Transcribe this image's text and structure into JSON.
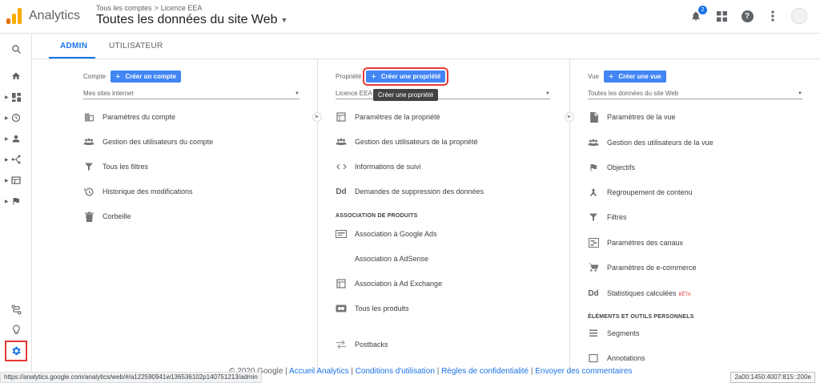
{
  "header": {
    "app_name": "Analytics",
    "breadcrumb_account": "Tous les comptes",
    "breadcrumb_sep": ">",
    "breadcrumb_property": "Licence EEA",
    "view_title": "Toutes les données du site Web",
    "notification_count": "2"
  },
  "tabs": {
    "admin": "ADMIN",
    "user": "UTILISATEUR"
  },
  "account": {
    "label": "Compte",
    "create": "Créer un compte",
    "selected": "Mes sites internet",
    "items": [
      "Paramètres du compte",
      "Gestion des utilisateurs du compte",
      "Tous les filtres",
      "Historique des modifications",
      "Corbeille"
    ]
  },
  "property": {
    "label": "Propriété",
    "create": "Créer une propriété",
    "tooltip": "Créer une propriété",
    "selected": "Licence EEA",
    "items": [
      "Paramètres de la propriété",
      "Gestion des utilisateurs de la propriété",
      "Informations de suivi",
      "Demandes de suppression des données"
    ],
    "products_heading": "ASSOCIATION DE PRODUITS",
    "product_items": [
      "Association à Google Ads",
      "Association à AdSense",
      "Association à Ad Exchange",
      "Tous les produits"
    ],
    "postbacks": "Postbacks",
    "dd_icon": "Dd"
  },
  "view": {
    "label": "Vue",
    "create": "Créer une vue",
    "selected": "Toutes les données du site Web",
    "items": [
      "Paramètres de la vue",
      "Gestion des utilisateurs de la vue",
      "Objectifs",
      "Regroupement de contenu",
      "Filtres",
      "Paramètres des canaux",
      "Paramètres de e-commerce",
      "Statistiques calculées"
    ],
    "beta": "BÊTA",
    "tools_heading": "ÉLÉMENTS ET OUTILS PERSONNELS",
    "tools_items": [
      "Segments",
      "Annotations"
    ],
    "dd_icon": "Dd"
  },
  "footer": {
    "copyright": "© 2020 Google",
    "sep": "|",
    "links": [
      "Accueil Analytics",
      "Conditions d'utilisation",
      "Règles de confidentialité",
      "Envoyer des commentaires"
    ]
  },
  "status_url": "https://analytics.google.com/analytics/web/#/a122590941w136536102p140751213/admin",
  "ip_address": "2a00:1450:4007:815::200e",
  "colors": {
    "accent": "#1a73e8",
    "button": "#4285f4",
    "highlight": "#e53935",
    "logo_orange": "#f9ab00",
    "logo_dark": "#e37400"
  }
}
